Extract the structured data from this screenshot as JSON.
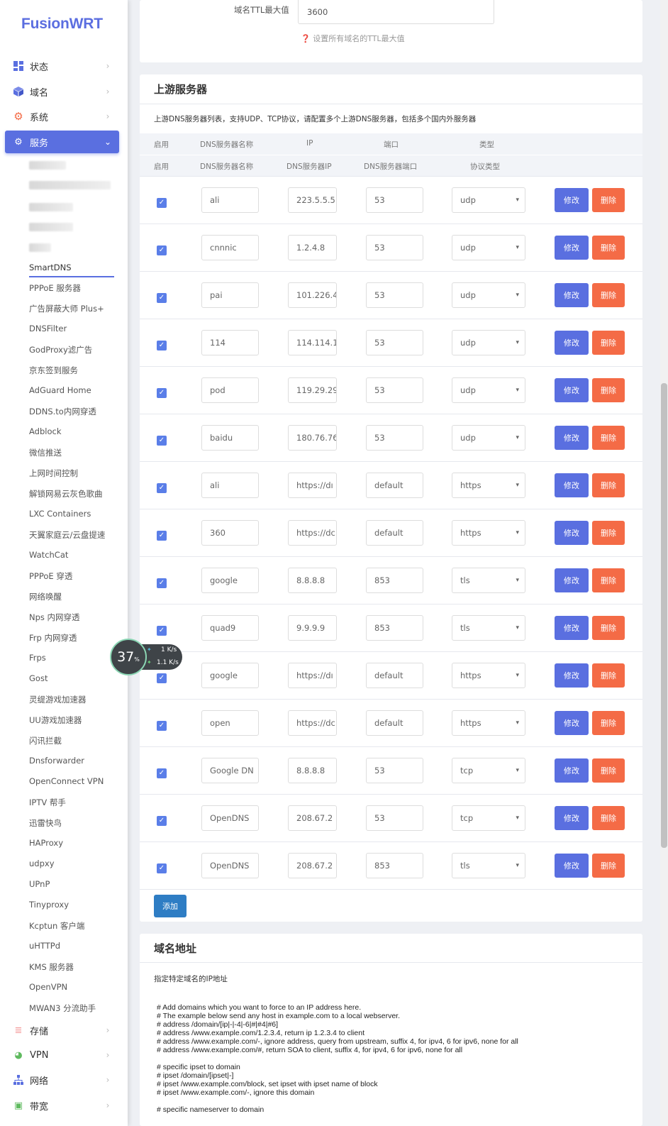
{
  "brand": "FusionWRT",
  "nav": [
    {
      "label": "状态",
      "icon": "dashboard-icon",
      "active": false
    },
    {
      "label": "域名",
      "icon": "cube-icon",
      "active": false
    },
    {
      "label": "系统",
      "icon": "gear-icon",
      "active": false
    },
    {
      "label": "服务",
      "icon": "cogs-icon",
      "active": true
    }
  ],
  "services": {
    "current": "SmartDNS",
    "items": [
      "PPPoE 服务器",
      "广告屏蔽大师 Plus+",
      "DNSFilter",
      "GodProxy滤广告",
      "京东签到服务",
      "AdGuard Home",
      "DDNS.to内网穿透",
      "Adblock",
      "微信推送",
      "上网时间控制",
      "解锁网易云灰色歌曲",
      "LXC Containers",
      "天翼家庭云/云盘提速",
      "WatchCat",
      "PPPoE 穿透",
      "网络唤醒",
      "Nps 内网穿透",
      "Frp 内网穿透",
      "Frps",
      "Gost",
      "灵缇游戏加速器",
      "UU游戏加速器",
      "闪讯拦截",
      "Dnsforwarder",
      "OpenConnect VPN",
      "IPTV 帮手",
      "迅雷快鸟",
      "HAProxy",
      "udpxy",
      "UPnP",
      "Tinyproxy",
      "Kcptun 客户端",
      "uHTTPd",
      "KMS 服务器",
      "OpenVPN",
      "MWAN3 分流助手"
    ]
  },
  "nav_bottom": [
    {
      "label": "存储",
      "icon": "database-icon"
    },
    {
      "label": "VPN",
      "icon": "globe-icon"
    },
    {
      "label": "网络",
      "icon": "sitemap-icon"
    },
    {
      "label": "带宽",
      "icon": "monitor-icon"
    }
  ],
  "ttl": {
    "label": "域名TTL最大值",
    "value": "3600",
    "help": "❓ 设置所有域名的TTL最大值"
  },
  "upstream": {
    "title": "上游服务器",
    "desc": "上游DNS服务器列表，支持UDP、TCP协议，请配置多个上游DNS服务器，包括多个国内外服务器",
    "head1": [
      "启用",
      "DNS服务器名称",
      "IP",
      "端口",
      "类型"
    ],
    "head2": [
      "启用",
      "DNS服务器名称",
      "DNS服务器IP",
      "DNS服务器端口",
      "协议类型"
    ],
    "edit_label": "修改",
    "delete_label": "删除",
    "add_label": "添加",
    "rows": [
      {
        "name": "ali",
        "ip": "223.5.5.5",
        "port": "53",
        "type": "udp"
      },
      {
        "name": "cnnnic",
        "ip": "1.2.4.8",
        "port": "53",
        "type": "udp"
      },
      {
        "name": "pai",
        "ip": "101.226.4",
        "port": "53",
        "type": "udp"
      },
      {
        "name": "114",
        "ip": "114.114.11",
        "port": "53",
        "type": "udp"
      },
      {
        "name": "pod",
        "ip": "119.29.29",
        "port": "53",
        "type": "udp"
      },
      {
        "name": "baidu",
        "ip": "180.76.76",
        "port": "53",
        "type": "udp"
      },
      {
        "name": "ali",
        "ip": "https://dı",
        "port": "default",
        "type": "https"
      },
      {
        "name": "360",
        "ip": "https://dc",
        "port": "default",
        "type": "https"
      },
      {
        "name": "google",
        "ip": "8.8.8.8",
        "port": "853",
        "type": "tls"
      },
      {
        "name": "quad9",
        "ip": "9.9.9.9",
        "port": "853",
        "type": "tls"
      },
      {
        "name": "google",
        "ip": "https://dı",
        "port": "default",
        "type": "https"
      },
      {
        "name": "open",
        "ip": "https://dc",
        "port": "default",
        "type": "https"
      },
      {
        "name": "Google DN",
        "ip": "8.8.8.8",
        "port": "53",
        "type": "tcp"
      },
      {
        "name": "OpenDNS",
        "ip": "208.67.2",
        "port": "53",
        "type": "tcp"
      },
      {
        "name": "OpenDNS",
        "ip": "208.67.2",
        "port": "853",
        "type": "tls"
      }
    ]
  },
  "domain": {
    "title": "域名地址",
    "desc": "指定特定域名的IP地址",
    "code1": "# Add domains which you want to force to an IP address here.\n# The example below send any host in example.com to a local webserver.\n# address /domain/[ip|-|-4|-6|#|#4|#6]\n# address /www.example.com/1.2.3.4, return ip 1.2.3.4 to client\n# address /www.example.com/-, ignore address, query from upstream, suffix 4, for ipv4, 6 for ipv6, none for all\n# address /www.example.com/#, return SOA to client, suffix 4, for ipv4, 6 for ipv6, none for all",
    "code2": "# specific ipset to domain\n# ipset /domain/[ipset|-]\n# ipset /www.example.com/block, set ipset with ipset name of block\n# ipset /www.example.com/-, ignore this domain",
    "code3": "# specific nameserver to domain"
  },
  "speed": {
    "percent": "37",
    "unit": "%",
    "up": "1 K/s",
    "down": "1.1 K/s"
  }
}
